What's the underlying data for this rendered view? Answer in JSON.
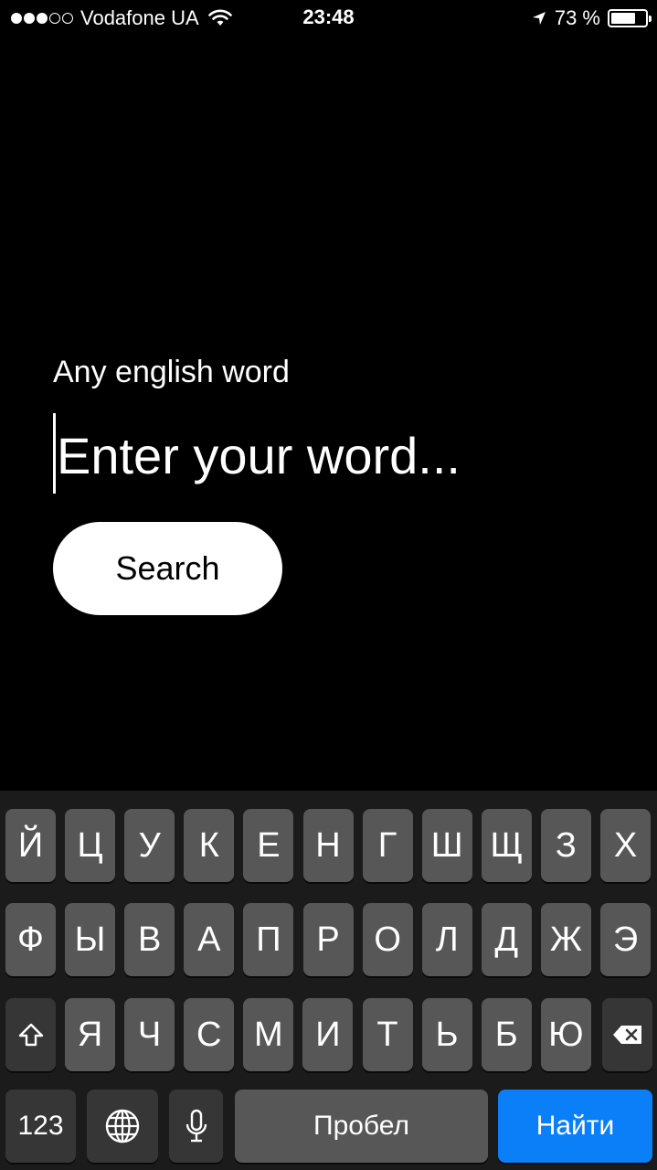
{
  "status_bar": {
    "signal_bars_filled": 3,
    "signal_bars_total": 5,
    "carrier": "Vodafone UA",
    "time": "23:48",
    "battery_percent": "73 %",
    "battery_level": 0.73
  },
  "form": {
    "label": "Any english word",
    "input_placeholder": "Enter your word...",
    "input_value": "",
    "search_label": "Search"
  },
  "keyboard": {
    "row1": [
      "Й",
      "Ц",
      "У",
      "К",
      "Е",
      "Н",
      "Г",
      "Ш",
      "Щ",
      "З",
      "Х"
    ],
    "row2": [
      "Ф",
      "Ы",
      "В",
      "А",
      "П",
      "Р",
      "О",
      "Л",
      "Д",
      "Ж",
      "Э"
    ],
    "row3": [
      "Я",
      "Ч",
      "С",
      "М",
      "И",
      "Т",
      "Ь",
      "Б",
      "Ю"
    ],
    "numbers_label": "123",
    "space_label": "Пробел",
    "return_label": "Найти",
    "return_color": "#0a7ff8"
  }
}
